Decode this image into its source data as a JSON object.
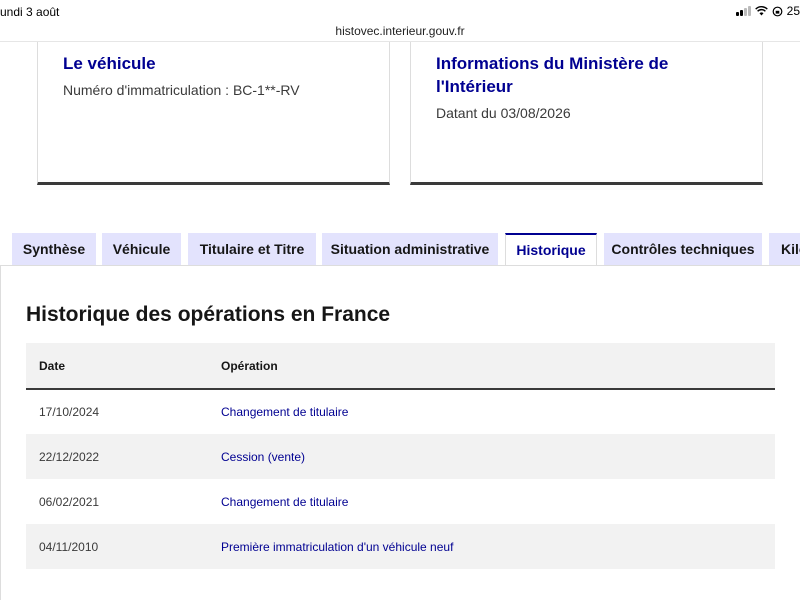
{
  "status_bar": {
    "time": "undi 3 août",
    "battery": "25"
  },
  "browser": {
    "url": "histovec.interieur.gouv.fr"
  },
  "cards": {
    "vehicle": {
      "title": "Le véhicule",
      "subtitle": "Numéro d'immatriculation : BC-1**-RV"
    },
    "ministry": {
      "title": "Informations du Ministère de l'Intérieur",
      "subtitle": "Datant du 03/08/2026"
    }
  },
  "tabs": [
    {
      "label": "Synthèse",
      "active": false
    },
    {
      "label": "Véhicule",
      "active": false
    },
    {
      "label": "Titulaire et Titre",
      "active": false
    },
    {
      "label": "Situation administrative",
      "active": false
    },
    {
      "label": "Historique",
      "active": true
    },
    {
      "label": "Contrôles techniques",
      "active": false
    },
    {
      "label": "Kilo",
      "active": false
    }
  ],
  "history": {
    "title": "Historique des opérations en France",
    "columns": [
      "Date",
      "Opération"
    ],
    "rows": [
      {
        "date": "17/10/2024",
        "operation": "Changement de titulaire"
      },
      {
        "date": "22/12/2022",
        "operation": "Cession (vente)"
      },
      {
        "date": "06/02/2021",
        "operation": "Changement de titulaire"
      },
      {
        "date": "04/11/2010",
        "operation": "Première immatriculation d'un véhicule neuf"
      }
    ]
  },
  "colors": {
    "brand_blue": "#000091",
    "tab_background": "#e3e3fd",
    "row_stripe": "#f2f2f2"
  }
}
